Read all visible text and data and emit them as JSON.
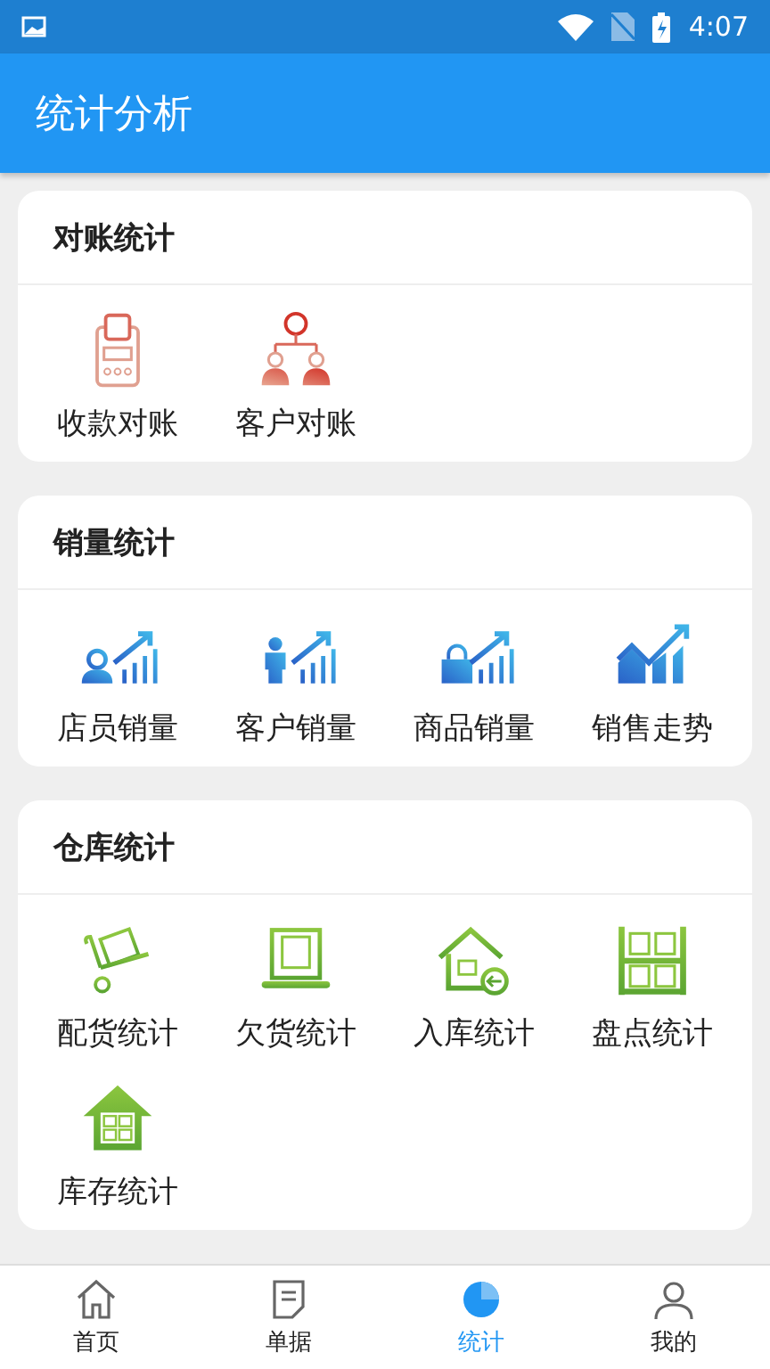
{
  "status_bar": {
    "time": "4:07"
  },
  "app_bar": {
    "title": "统计分析"
  },
  "sections": [
    {
      "title": "对账统计",
      "items": [
        {
          "label": "收款对账"
        },
        {
          "label": "客户对账"
        }
      ]
    },
    {
      "title": "销量统计",
      "items": [
        {
          "label": "店员销量"
        },
        {
          "label": "客户销量"
        },
        {
          "label": "商品销量"
        },
        {
          "label": "销售走势"
        }
      ]
    },
    {
      "title": "仓库统计",
      "items": [
        {
          "label": "配货统计"
        },
        {
          "label": "欠货统计"
        },
        {
          "label": "入库统计"
        },
        {
          "label": "盘点统计"
        },
        {
          "label": "库存统计"
        }
      ]
    }
  ],
  "nav": [
    {
      "label": "首页",
      "selected": false
    },
    {
      "label": "单据",
      "selected": false
    },
    {
      "label": "统计",
      "selected": true
    },
    {
      "label": "我的",
      "selected": false
    }
  ]
}
